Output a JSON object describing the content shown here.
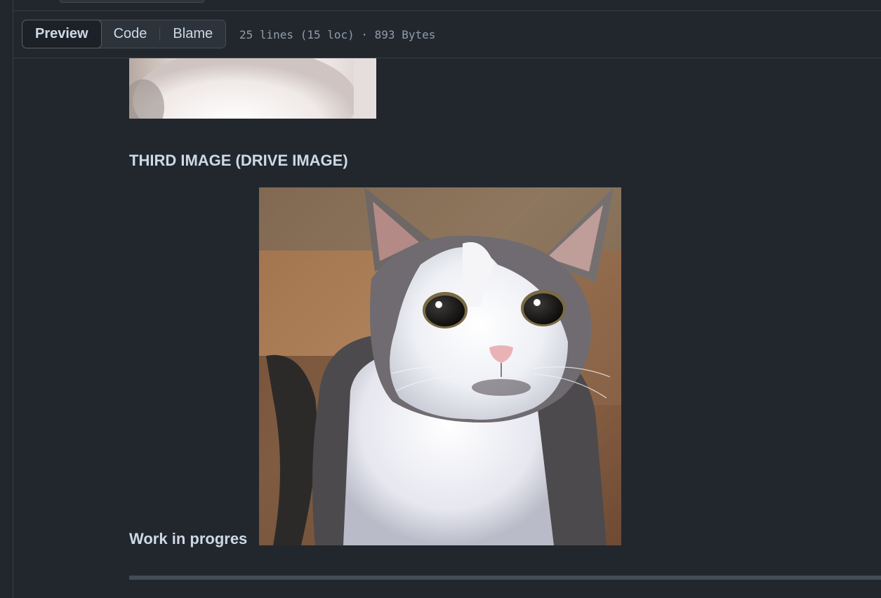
{
  "toolbar": {
    "tabs": [
      {
        "label": "Preview",
        "active": true
      },
      {
        "label": "Code",
        "active": false
      },
      {
        "label": "Blame",
        "active": false
      }
    ],
    "file_meta": "25 lines (15 loc) · 893 Bytes"
  },
  "readme": {
    "heading": "THIRD IMAGE (DRIVE IMAGE)",
    "wip_text": "Work in progres"
  },
  "colors": {
    "background": "#22272e",
    "border": "#373e47",
    "text": "#cdd9e5",
    "muted": "#909dab"
  }
}
